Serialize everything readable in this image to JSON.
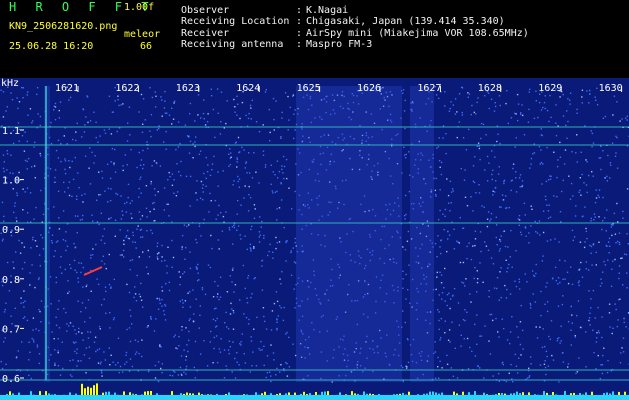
{
  "header": {
    "app_title": "H R O F F T",
    "version": "1.00f",
    "filename": "KN9_2506281620.png",
    "meleor_label": "meleor",
    "meleor_count": "66",
    "datetime": "25.06.28 16:20"
  },
  "station_info": [
    {
      "key": "Observer",
      "value": "K.Nagai"
    },
    {
      "key": "Receiving Location",
      "value": "Chigasaki, Japan (139.414 35.340)"
    },
    {
      "key": "Receiver",
      "value": "AirSpy mini (Miakejima VOR 108.65MHz)"
    },
    {
      "key": "Receiving antenna",
      "value": "Maspro FM-3"
    }
  ],
  "spectrogram": {
    "y_unit": "kHz",
    "y_ticks": [
      "1.1",
      "1.0",
      "0.9",
      "0.8",
      "0.7",
      "0.6"
    ],
    "time_ticks": [
      "1621",
      "1622",
      "1623",
      "1624",
      "1625",
      "1626",
      "1627",
      "1628",
      "1629",
      "1630"
    ],
    "colors": {
      "background": "#0a1a78",
      "noise": "#3a6cff",
      "line": "#39d6c8",
      "bar_base": "#26d6ff",
      "bar_peak": "#ffff00",
      "meteor": "#ff3a3a"
    }
  }
}
